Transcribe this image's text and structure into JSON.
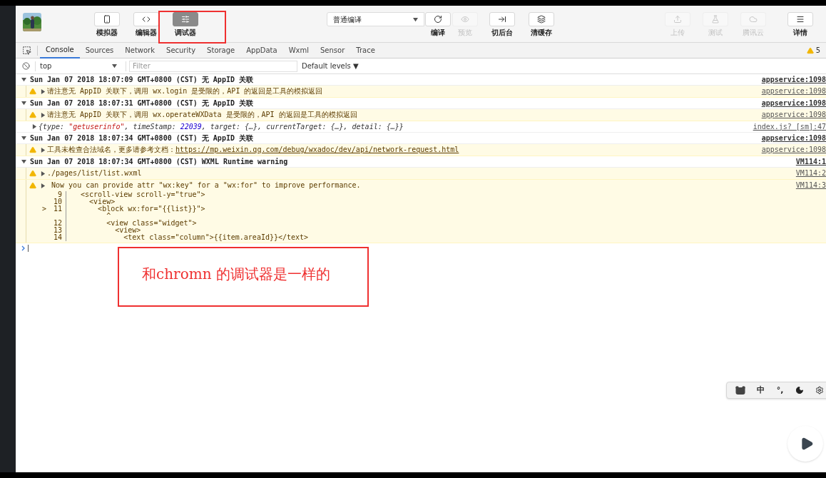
{
  "toolbar": {
    "left_buttons": [
      {
        "label": "模拟器",
        "selected": false
      },
      {
        "label": "编辑器",
        "selected": false
      },
      {
        "label": "调试器",
        "selected": true
      }
    ],
    "compile_mode": "普通编译",
    "mid_buttons": [
      {
        "label": "编译",
        "disabled": false
      },
      {
        "label": "预览",
        "disabled": true
      },
      {
        "label": "切后台",
        "disabled": false
      },
      {
        "label": "清缓存",
        "disabled": false
      }
    ],
    "right_buttons": [
      {
        "label": "上传",
        "disabled": true
      },
      {
        "label": "测试",
        "disabled": true
      },
      {
        "label": "腾讯云",
        "disabled": true
      },
      {
        "label": "详情",
        "disabled": false
      }
    ]
  },
  "devtools": {
    "tabs": [
      {
        "label": "Console",
        "selected": true
      },
      {
        "label": "Sources",
        "selected": false
      },
      {
        "label": "Network",
        "selected": false
      },
      {
        "label": "Security",
        "selected": false
      },
      {
        "label": "Storage",
        "selected": false
      },
      {
        "label": "AppData",
        "selected": false
      },
      {
        "label": "Wxml",
        "selected": false
      },
      {
        "label": "Sensor",
        "selected": false
      },
      {
        "label": "Trace",
        "selected": false
      }
    ],
    "warning_count": "5",
    "context": "top",
    "filter_placeholder": "Filter",
    "levels": "Default levels ▼"
  },
  "console": [
    {
      "kind": "group",
      "text": "Sun Jan 07 2018 18:07:09 GMT+0800 (CST) 无 AppID 关联",
      "source": "appservice:1098"
    },
    {
      "kind": "warning",
      "text": "请注意无 AppID 关联下，调用 wx.login 是受限的，API 的返回是工具的模拟返回",
      "source": "appservice:1098"
    },
    {
      "kind": "group",
      "text": "Sun Jan 07 2018 18:07:31 GMT+0800 (CST) 无 AppID 关联",
      "source": "appservice:1098"
    },
    {
      "kind": "warning",
      "text": "请注意无 AppID 关联下，调用 wx.operateWXData 是受限的，API 的返回是工具的模拟返回",
      "source": "appservice:1098"
    },
    {
      "kind": "object",
      "parts": [
        {
          "text": "{type: "
        },
        {
          "color": "#c41a16",
          "text": "\"getuserinfo\""
        },
        {
          "text": ", timeStamp: "
        },
        {
          "color": "#1c00cf",
          "text": "22039"
        },
        {
          "text": ", target: {…}, currentTarget: {…}, detail: {…}}"
        }
      ],
      "source": "index.js? [sm]:47"
    },
    {
      "kind": "group",
      "text": "Sun Jan 07 2018 18:07:34 GMT+0800 (CST) 无 AppID 关联",
      "source": "appservice:1098"
    },
    {
      "kind": "warning",
      "text": "工具未检查合法域名，更多请参考文档：",
      "link": "https://mp.weixin.qq.com/debug/wxadoc/dev/api/network-request.html",
      "source": "appservice:1098"
    },
    {
      "kind": "group",
      "text": "Sun Jan 07 2018 18:07:34 GMT+0800 (CST) WXML Runtime warning",
      "source": "VM114:1"
    },
    {
      "kind": "warning",
      "text": "./pages/list/list.wxml",
      "source": "VM114:2"
    },
    {
      "kind": "warning",
      "text": " Now you can provide attr \"wx:key\" for a \"wx:for\" to improve performance.",
      "source": "VM114:3",
      "lines": [
        {
          "number": "9",
          "code": "  <scroll-view scroll-y=\"true\">"
        },
        {
          "number": "10",
          "code": "    <view>"
        },
        {
          "marker": ">",
          "number": "11",
          "code": "      <block wx:for=\"{{list}}\">"
        },
        {
          "code": "        ^"
        },
        {
          "number": "12",
          "code": "        <view class=\"widget\">"
        },
        {
          "number": "13",
          "code": "          <view>"
        },
        {
          "number": "14",
          "code": "            <text class=\"column\">{{item.areaId}}</text>"
        }
      ]
    }
  ],
  "note": "和chromn 的调试器是一样的",
  "ime": [
    "中",
    "°,"
  ]
}
